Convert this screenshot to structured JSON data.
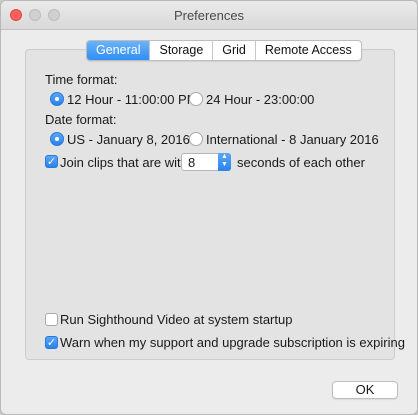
{
  "window": {
    "title": "Preferences"
  },
  "tabs": [
    "General",
    "Storage",
    "Grid",
    "Remote Access"
  ],
  "active_tab": "General",
  "time_format": {
    "label": "Time format:",
    "options": [
      "12 Hour - 11:00:00 PM",
      "24 Hour - 23:00:00"
    ],
    "selected": "12 Hour - 11:00:00 PM"
  },
  "date_format": {
    "label": "Date format:",
    "options": [
      "US - January 8, 2016",
      "International - 8 January 2016"
    ],
    "selected": "US - January 8, 2016"
  },
  "join_clips": {
    "checked": true,
    "label_before": "Join clips that are within",
    "value": "8",
    "label_after": "seconds of each other"
  },
  "run_at_startup": {
    "checked": false,
    "label": "Run Sighthound Video at system startup"
  },
  "warn_subscription": {
    "checked": true,
    "label": "Warn when my support and upgrade subscription is expiring"
  },
  "buttons": {
    "ok": "OK"
  },
  "colors": {
    "accent": "#2f8ef5",
    "close": "#fc605c"
  },
  "icons": {
    "checkmark": "checkmark-icon",
    "stepper": "stepper-arrows-icon"
  }
}
